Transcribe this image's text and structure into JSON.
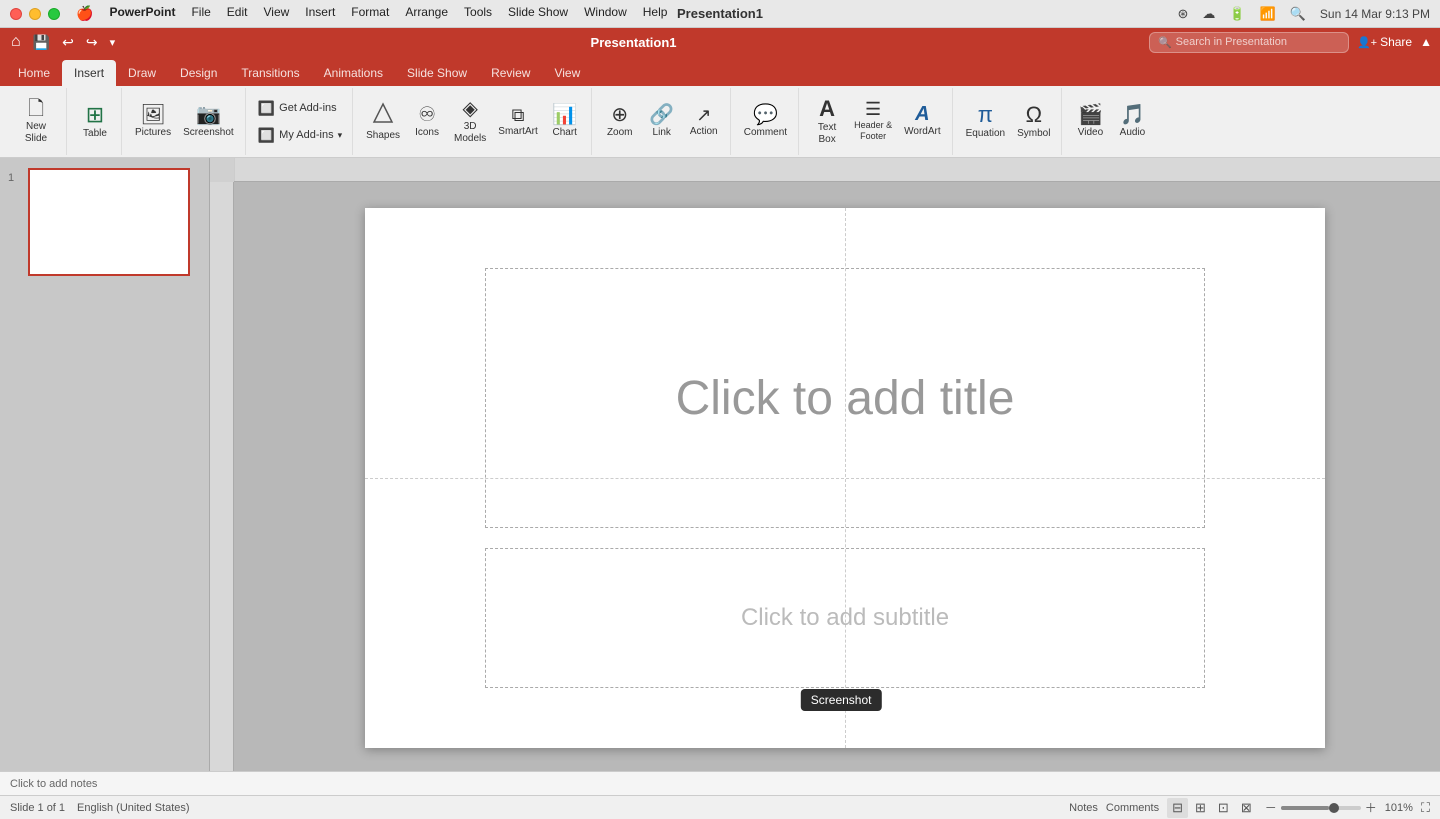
{
  "app": {
    "name": "PowerPoint",
    "title": "Presentation1"
  },
  "macos": {
    "date": "Sun 14 Mar",
    "time": "9:13 PM",
    "menus": [
      "Apple",
      "PowerPoint",
      "File",
      "Edit",
      "View",
      "Insert",
      "Format",
      "Arrange",
      "Tools",
      "Slide Show",
      "Window",
      "Help"
    ]
  },
  "quick_access": {
    "buttons": [
      "home",
      "save",
      "undo",
      "redo",
      "dropdown"
    ]
  },
  "tabs": [
    {
      "id": "home",
      "label": "Home"
    },
    {
      "id": "insert",
      "label": "Insert",
      "active": true
    },
    {
      "id": "draw",
      "label": "Draw"
    },
    {
      "id": "design",
      "label": "Design"
    },
    {
      "id": "transitions",
      "label": "Transitions"
    },
    {
      "id": "animations",
      "label": "Animations"
    },
    {
      "id": "slideshow",
      "label": "Slide Show"
    },
    {
      "id": "review",
      "label": "Review"
    },
    {
      "id": "view",
      "label": "View"
    }
  ],
  "toolbar": {
    "groups": [
      {
        "id": "slides",
        "items": [
          {
            "id": "new-slide",
            "icon": "🗋",
            "label": "New\nSlide",
            "has_arrow": true
          }
        ]
      },
      {
        "id": "tables",
        "items": [
          {
            "id": "table",
            "icon": "⊞",
            "label": "Table",
            "has_arrow": true
          }
        ]
      },
      {
        "id": "images",
        "items": [
          {
            "id": "pictures",
            "icon": "🖼",
            "label": "Pictures",
            "has_arrow": true
          },
          {
            "id": "screenshot",
            "icon": "📷",
            "label": "Screenshot",
            "has_arrow": true
          }
        ]
      },
      {
        "id": "addins",
        "items": [
          {
            "id": "get-addins",
            "icon": "🔲",
            "label": "Get Add-ins"
          },
          {
            "id": "my-addins",
            "icon": "🔲",
            "label": "My Add-ins",
            "has_arrow": true
          }
        ]
      },
      {
        "id": "illustrations",
        "items": [
          {
            "id": "shapes",
            "icon": "△",
            "label": "Shapes",
            "has_arrow": true
          },
          {
            "id": "icons",
            "icon": "♾",
            "label": "Icons"
          },
          {
            "id": "3dmodels",
            "icon": "◈",
            "label": "3D\nModels",
            "has_arrow": true
          },
          {
            "id": "smartart",
            "icon": "⧉",
            "label": "SmartArt",
            "has_arrow": true
          },
          {
            "id": "chart",
            "icon": "📊",
            "label": "Chart",
            "has_arrow": true
          }
        ]
      },
      {
        "id": "links",
        "items": [
          {
            "id": "zoom",
            "icon": "⊕",
            "label": "Zoom",
            "has_arrow": true
          },
          {
            "id": "link",
            "icon": "🔗",
            "label": "Link"
          },
          {
            "id": "action",
            "icon": "↗",
            "label": "Action"
          }
        ]
      },
      {
        "id": "comments",
        "items": [
          {
            "id": "comment",
            "icon": "💬",
            "label": "Comment"
          }
        ]
      },
      {
        "id": "text_group",
        "items": [
          {
            "id": "textbox",
            "icon": "A",
            "label": "Text\nBox",
            "has_arrow": true
          },
          {
            "id": "header-footer",
            "icon": "☰",
            "label": "Header &\nFooter"
          },
          {
            "id": "wordart",
            "icon": "A̲",
            "label": "WordArt",
            "has_arrow": true
          }
        ]
      },
      {
        "id": "symbols_group",
        "items": [
          {
            "id": "equation",
            "icon": "π",
            "label": "Equation",
            "has_arrow": true
          },
          {
            "id": "symbol",
            "icon": "Ω",
            "label": "Symbol"
          }
        ]
      },
      {
        "id": "media",
        "items": [
          {
            "id": "video",
            "icon": "▶",
            "label": "Video",
            "has_arrow": true
          },
          {
            "id": "audio",
            "icon": "♪",
            "label": "Audio",
            "has_arrow": true
          }
        ]
      }
    ]
  },
  "slide": {
    "title_placeholder": "Click to add title",
    "subtitle_placeholder": "Click to add subtitle",
    "notes_placeholder": "Click to add notes"
  },
  "status_bar": {
    "slide_info": "Slide 1 of 1",
    "language": "English (United States)",
    "notes_label": "Notes",
    "comments_label": "Comments",
    "zoom_level": "101%"
  },
  "header": {
    "search_placeholder": "Search in Presentation",
    "share_label": "Share"
  },
  "tooltip": {
    "screenshot": "Screenshot"
  }
}
